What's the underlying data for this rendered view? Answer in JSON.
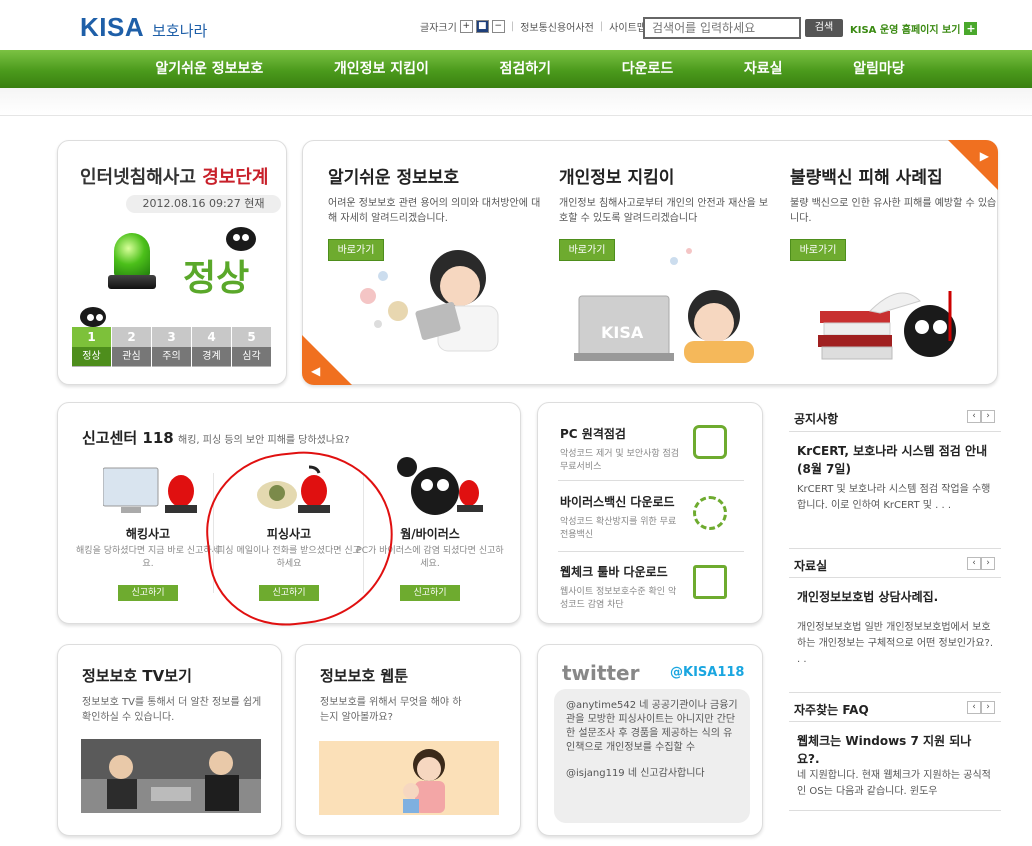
{
  "header": {
    "logo_mark": "KISA",
    "logo_sub": "보호나라",
    "font_size_label": "글자크기",
    "font_btns": [
      "+",
      "■",
      "−"
    ],
    "dict_link": "정보통신용어사전",
    "sitemap_link": "사이트맵",
    "search_placeholder": "검색어를 입력하세요",
    "search_button": "검색",
    "kisa_link": "KISA 운영 홈페이지 보기",
    "kisa_plus": "+"
  },
  "nav": {
    "items": [
      "알기쉬운 정보보호",
      "개인정보 지킴이",
      "점검하기",
      "다운로드",
      "자료실",
      "알림마당"
    ]
  },
  "alert": {
    "title_prefix": "인터넷침해사고 ",
    "title_red": "경보단계",
    "date": "2012.08.16 09:27  현재",
    "status": "정상",
    "levels": [
      {
        "num": "1",
        "label": "정상"
      },
      {
        "num": "2",
        "label": "관심"
      },
      {
        "num": "3",
        "label": "주의"
      },
      {
        "num": "4",
        "label": "경계"
      },
      {
        "num": "5",
        "label": "심각"
      }
    ]
  },
  "features": [
    {
      "title": "알기쉬운 정보보호",
      "desc": "어려운 정보보호 관련 용어의 의미와 대처방안에 대해 자세히 알려드리겠습니다.",
      "btn": "바로가기"
    },
    {
      "title": "개인정보 지킴이",
      "desc": "개인정보 침해사고로부터 개인의 안전과 재산을 보호할 수 있도록 알려드리겠습니다",
      "btn": "바로가기"
    },
    {
      "title": "불량백신 피해 사례집",
      "desc": "불량 백신으로 인한 유사한 피해를 예방할 수 있습니다.",
      "btn": "바로가기"
    }
  ],
  "feature_arrows": {
    "next": "▶",
    "prev": "◀"
  },
  "laptop_label": "KISA",
  "report": {
    "title": "신고센터 118",
    "subtitle": "해킹, 피싱 등의 보안 피해를 당하셨나요?",
    "items": [
      {
        "name": "해킹사고",
        "desc": "해킹을 당하셨다면 지금 바로 신고하세요.",
        "btn": "신고하기"
      },
      {
        "name": "피싱사고",
        "desc": "피싱 메일이나 전화를 받으셨다면 신고하세요",
        "btn": "신고하기"
      },
      {
        "name": "웜/바이러스",
        "desc": "PC가 바이러스에 감염 되셨다면 신고하세요.",
        "btn": "신고하기"
      }
    ]
  },
  "utilities": [
    {
      "title": "PC 원격점검",
      "desc": "악성코드 제거 및 보안사항 점검 무료서비스"
    },
    {
      "title": "바이러스백신 다운로드",
      "desc": "악성코드 확산방지를 위한 무료 전용백신"
    },
    {
      "title": "웹체크 툴바 다운로드",
      "desc": "웹사이트 정보보호수준 확인 악성코드 감염 차단"
    }
  ],
  "tv": {
    "title": "정보보호 TV보기",
    "desc": "정보보호 TV를 통해서 더 알찬 정보를 쉽게 확인하실 수 있습니다."
  },
  "webtoon": {
    "title": "정보보호 웹툰",
    "desc": "정보보호를 위해서 무엇을 해야 하는지 알아볼까요?"
  },
  "twitter": {
    "logo": "twitter",
    "handle": "@KISA118",
    "tweet1": "@anytime542 네 공공기관이나 금융기관을 모방한 피싱사이트는 아니지만 간단한 설문조사 후 경품을 제공하는 식의 유인책으로 개인정보를 수집할 수",
    "tweet2": "@isjang119 네 신고감사합니다"
  },
  "side": {
    "pager": [
      "‹",
      "›"
    ],
    "notice": {
      "head": "공지사항",
      "title": "KrCERT, 보호나라 시스템 점검 안내 (8월 7일)",
      "desc": "KrCERT 및 보호나라 시스템 점검 작업을 수행합니다. 이로 인하여 KrCERT 및 . . ."
    },
    "library": {
      "head": "자료실",
      "title": "개인정보보호법 상담사례집.",
      "desc": "개인정보보호법 일반 개인정보보호법에서 보호하는 개인정보는 구체적으로 어떤 정보인가요?. . ."
    },
    "faq": {
      "head": "자주찾는 FAQ",
      "title": "웹체크는 Windows 7 지원 되나요?.",
      "desc": "네 지원합니다. 현재 웹체크가 지원하는 공식적인 OS는 다음과 같습니다. 윈도우"
    }
  }
}
